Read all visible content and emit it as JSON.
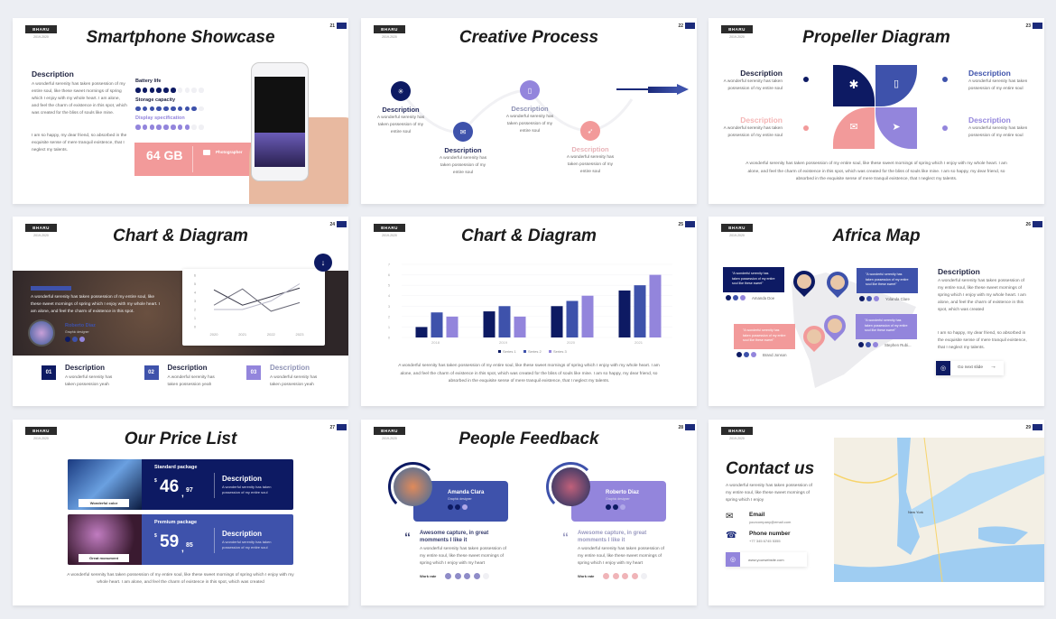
{
  "colors": {
    "navy": "#0d1a63",
    "blue": "#3e52ab",
    "purple": "#9385dc",
    "pink": "#f29a9a"
  },
  "slides": [
    {
      "number": "21",
      "badge": "BHARU",
      "year": "2019-2020",
      "title": "Smartphone Showcase"
    },
    {
      "number": "22",
      "badge": "BHARU",
      "year": "2019-2020",
      "title": "Creative Process"
    },
    {
      "number": "23",
      "badge": "BHARU",
      "year": "2019-2020",
      "title": "Propeller Diagram"
    },
    {
      "number": "24",
      "badge": "BHARU",
      "year": "2019-2020",
      "title": "Chart & Diagram"
    },
    {
      "number": "25",
      "badge": "BHARU",
      "year": "2019-2020",
      "title": "Chart & Diagram"
    },
    {
      "number": "26",
      "badge": "BHARU",
      "year": "2019-2020",
      "title": "Africa Map"
    },
    {
      "number": "27",
      "badge": "BHARU",
      "year": "2019-2020",
      "title": "Our Price List"
    },
    {
      "number": "28",
      "badge": "BHARU",
      "year": "2019-2020",
      "title": "People Feedback"
    },
    {
      "number": "29",
      "badge": "BHARU",
      "year": "2019-2020",
      "title": "Contact us"
    }
  ],
  "showcase": {
    "heading": "Description",
    "p1": "A wonderful serenity has taken possession of my entire soul, like these sweet mornings of spring which I enjoy with my whole heart. I am alone, and feel the charm of existence in this spot, which was created for the bliss of souls like mine.",
    "p2": "I am so happy, my dear friend, so absorbed in the exquisite sense of mere tranquil existence, that I neglect my talents.",
    "ratings": [
      {
        "label": "Battery life",
        "filled": 6,
        "total": 10,
        "color": "#0d1a63"
      },
      {
        "label": "Storage capacity",
        "filled": 9,
        "total": 10,
        "color": "#3e52ab"
      },
      {
        "label": "Display specification",
        "filled": 8,
        "total": 10,
        "color": "#9385dc"
      }
    ],
    "storage": "64 GB",
    "feature": "Photographer"
  },
  "process": {
    "steps": [
      {
        "title": "Description",
        "text": "A wonderful serenity has taken possession of my entire soul",
        "icon": "asterisk-icon"
      },
      {
        "title": "Description",
        "text": "A wonderful serenity has taken possession of my entire soul",
        "icon": "mail-icon"
      },
      {
        "title": "Description",
        "text": "A wonderful serenity has taken possession of my entire soul",
        "icon": "document-icon"
      },
      {
        "title": "Description",
        "text": "A wonderful serenity has taken possession of my entire soul",
        "icon": "rocket-icon"
      }
    ]
  },
  "propeller": {
    "items": [
      {
        "title": "Description",
        "text": "A wonderful serenity has taken possession of my entire soul"
      },
      {
        "title": "Description",
        "text": "A wonderful serenity has taken possession of my entire soul"
      },
      {
        "title": "Description",
        "text": "A wonderful serenity has taken possession of my entire soul"
      },
      {
        "title": "Description",
        "text": "A wonderful serenity has taken possession of my entire soul"
      }
    ],
    "paragraph": "A wonderful serenity has taken possession of my entire soul, like these sweet mornings of spring which I enjoy with my whole heart. I am alone, and feel the charm of existence in this spot, which was created for the bliss of souls like mine. I am so happy, my dear friend, so absorbed in the exquisite sense of mere tranquil existence, that I neglect my talents."
  },
  "chart_slide": {
    "band_text": "A wonderful serenity has taken possession of my entire soul, like these sweet mornings of spring which I enjoy with my whole heart. I am alone, and feel the charm of existence in this spot.",
    "person": "Roberto Diaz",
    "role": "Graphic designer",
    "items": [
      {
        "num": "01",
        "title": "Description",
        "text": "A wonderful serenity has taken possession yeah"
      },
      {
        "num": "02",
        "title": "Description",
        "text": "A wonderful serenity has taken possession yeah"
      },
      {
        "num": "03",
        "title": "Description",
        "text": "A wonderful serenity has taken possession yeah"
      }
    ]
  },
  "bar_slide": {
    "paragraph": "A wonderful serenity has taken possession of my entire soul, like these sweet mornings of spring which I enjoy with my whole heart. I am alone, and feel the charm of existence in this spot, which was created for the bliss of souls like mine. I am so happy, my dear friend, so absorbed in the exquisite sense of mere tranquil existence, that I neglect my talents."
  },
  "chart_data": [
    {
      "type": "line",
      "categories": [
        "2020",
        "2021",
        "2022",
        "2023"
      ],
      "ylim": [
        0,
        6
      ],
      "yticks": [
        "0",
        "1",
        "2",
        "3",
        "4",
        "5",
        "6"
      ],
      "grid": false,
      "series": [
        {
          "values": [
            4.3,
            2.5,
            3.5,
            4.5
          ],
          "color": "#3a3a4a"
        },
        {
          "values": [
            2.5,
            4.4,
            1.8,
            2.8
          ],
          "color": "#6a6a78"
        },
        {
          "values": [
            2,
            2,
            3,
            5
          ],
          "color": "#b8b8c8"
        }
      ]
    },
    {
      "type": "bar",
      "categories": [
        "2018",
        "2019",
        "2020",
        "2021"
      ],
      "ylim": [
        0,
        7
      ],
      "yticks": [
        "0",
        "1",
        "2",
        "3",
        "4",
        "5",
        "6",
        "7"
      ],
      "grid": true,
      "legend": "bottom",
      "series": [
        {
          "name": "Series 1",
          "values": [
            1,
            2.5,
            3,
            4.5
          ],
          "color": "#0d1a63"
        },
        {
          "name": "Series 2",
          "values": [
            2.4,
            3,
            3.5,
            5
          ],
          "color": "#3e52ab"
        },
        {
          "name": "Series 3",
          "values": [
            2,
            2,
            4,
            6
          ],
          "color": "#9385dc"
        }
      ]
    }
  ],
  "map_slide": {
    "quote": "\"A wonderful serenity has taken possession of my entire soul like these sweet\"",
    "people": [
      "Amanda Doe",
      "Yolanda Clare",
      "Brand Jonson",
      "Stephen Rubi..."
    ],
    "heading": "Description",
    "p1": "A wonderful serenity has taken possession of my entire soul, like these sweet mornings of spring which I enjoy with my whole heart. I am alone, and feel the charm of existence in this spot, which was created",
    "p2": "I am so happy, my dear friend, so absorbed in the exquisite sense of mere tranquil existence, that I neglect my talents.",
    "button": "Go next slide"
  },
  "price": {
    "packages": [
      {
        "name": "Standard package",
        "currency": "$",
        "price": "46",
        "cents": "97",
        "tag": "Wonderful color",
        "title": "Description",
        "text": "A wonderful serenity has taken possession of my entire soul"
      },
      {
        "name": "Premium package",
        "currency": "$",
        "price": "59",
        "cents": "85",
        "tag": "Great monument",
        "title": "Description",
        "text": "A wonderful serenity has taken possession of my entire soul"
      }
    ],
    "paragraph": "A wonderful serenity has taken possession of my entire soul, like these sweet mornings of spring which I enjoy with my whole heart. I am alone, and feel the charm of existence in this spot, which was created"
  },
  "feedback": {
    "people": [
      {
        "name": "Amanda Clara",
        "role": "Graphic designer",
        "quote": "Awesome capture, in great momments I like it",
        "text": "A wonderful serenity has taken possession of my entire soul, like these sweet mornings of spring which I enjoy with my heart",
        "rate_label": "Work rate",
        "rate": 4,
        "rate_total": 5
      },
      {
        "name": "Roberto Diaz",
        "role": "Graphic designer",
        "quote": "Awesome capture, in great momments I like it",
        "text": "A wonderful serenity has taken possession of my entire soul, like these sweet mornings of spring which I enjoy with my heart",
        "rate_label": "Work rate",
        "rate": 4,
        "rate_total": 5
      }
    ]
  },
  "contact": {
    "text": "A wonderful serenity has taken possession of my entire soul, like these sweet mornings of spring which I enjoy",
    "email_label": "Email",
    "email": "yourcompany@email.com",
    "phone_label": "Phone number",
    "phone": "+77 345 6745 5355",
    "website": "www.yourwebsite.com",
    "map_label": "New York"
  }
}
